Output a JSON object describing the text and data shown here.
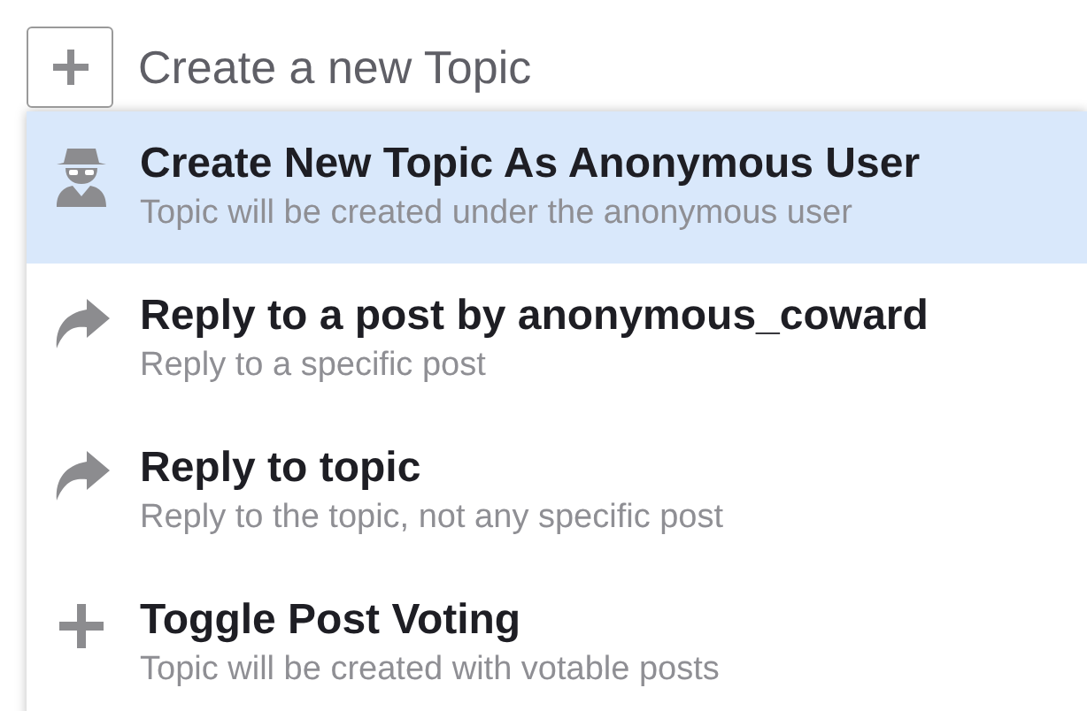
{
  "create_button": {
    "label": "Create a new Topic"
  },
  "menu": {
    "items": [
      {
        "kind": "anonymous",
        "title": "Create New Topic As Anonymous User",
        "description": "Topic will be created under the anonymous user",
        "selected": true
      },
      {
        "kind": "reply",
        "title": "Reply to a post by anonymous_coward",
        "description": "Reply to a specific post",
        "selected": false
      },
      {
        "kind": "reply",
        "title": "Reply to topic",
        "description": "Reply to the topic, not any specific post",
        "selected": false
      },
      {
        "kind": "plus",
        "title": "Toggle Post Voting",
        "description": "Topic will be created with votable posts",
        "selected": false
      }
    ]
  }
}
